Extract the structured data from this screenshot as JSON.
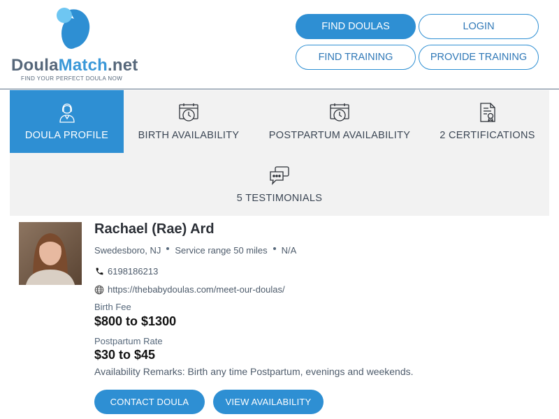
{
  "brand": {
    "name_main": "Doula",
    "name_accent": "Match",
    "name_suffix": ".net",
    "tagline": "FIND YOUR PERFECT DOULA NOW",
    "colors": {
      "primary": "#2e8fd3",
      "text": "#56677a",
      "accent": "#3a98d8"
    }
  },
  "nav": {
    "find_doulas": "FIND DOULAS",
    "login": "LOGIN",
    "find_training": "FIND TRAINING",
    "provide_training": "PROVIDE TRAINING"
  },
  "tabs": [
    {
      "label": "DOULA PROFILE",
      "icon": "doula-person-icon",
      "active": true
    },
    {
      "label": "BIRTH AVAILABILITY",
      "icon": "calendar-clock-icon",
      "active": false
    },
    {
      "label": "POSTPARTUM AVAILABILITY",
      "icon": "calendar-clock-icon",
      "active": false
    },
    {
      "label": "2 CERTIFICATIONS",
      "icon": "certificate-icon",
      "active": false
    },
    {
      "label": "5 TESTIMONIALS",
      "icon": "chat-bubbles-icon",
      "active": false
    }
  ],
  "profile": {
    "name": "Rachael (Rae) Ard",
    "location": "Swedesboro, NJ",
    "service_range": "Service range 50 miles",
    "extra": "N/A",
    "phone": "6198186213",
    "website": "https://thebabydoulas.com/meet-our-doulas/",
    "birth_fee_label": "Birth Fee",
    "birth_fee": "$800 to $1300",
    "postpartum_rate_label": "Postpartum Rate",
    "postpartum_rate": "$30 to $45",
    "remarks": "Availability Remarks: Birth any time Postpartum, evenings and weekends."
  },
  "actions": {
    "contact": "CONTACT DOULA",
    "view_availability": "VIEW AVAILABILITY"
  }
}
